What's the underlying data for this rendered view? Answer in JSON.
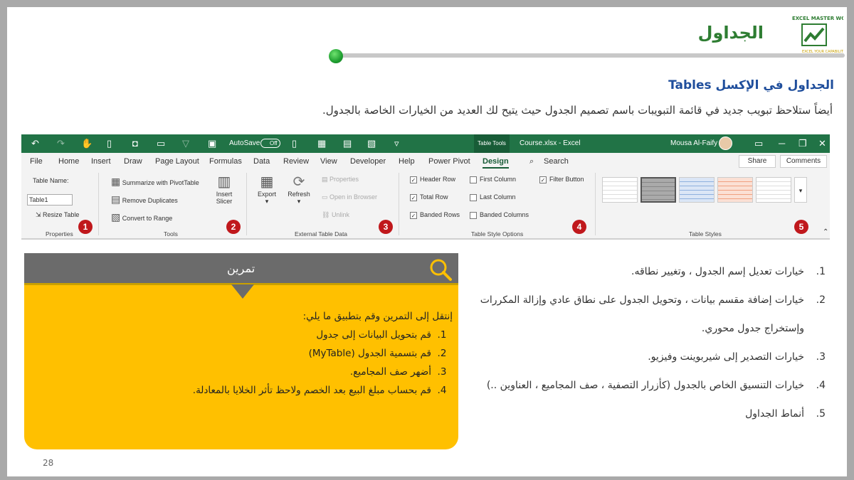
{
  "slide": {
    "title": "الجداول",
    "subtitle": "الجداول في الإكسل Tables",
    "intro": "أيضاً ستلاحظ تبويب جديد في قائمة التبويبات باسم تصميم الجدول حيث يتيح لك العديد من الخيارات الخاصة بالجدول.",
    "page": "28"
  },
  "logo": {
    "brand": "EXCEL MASTER WORK",
    "tagline": "EXCEL YOUR CAPABILITY"
  },
  "excel": {
    "autosave": "AutoSave",
    "autosave_state": "Off",
    "table_tools": "Table Tools",
    "filename": "Course.xlsx - Excel",
    "user": "Mousa Al-Faify",
    "tabs": [
      "File",
      "Home",
      "Insert",
      "Draw",
      "Page Layout",
      "Formulas",
      "Data",
      "Review",
      "View",
      "Developer",
      "Help",
      "Power Pivot",
      "Design"
    ],
    "search": "Search",
    "share": "Share",
    "comments": "Comments",
    "properties": {
      "table_name_label": "Table Name:",
      "table_name": "Table1",
      "resize": "Resize Table",
      "label": "Properties"
    },
    "tools": {
      "summarize": "Summarize with PivotTable",
      "remove_dup": "Remove Duplicates",
      "convert": "Convert to Range",
      "slicer1": "Insert",
      "slicer2": "Slicer",
      "label": "Tools"
    },
    "external": {
      "export": "Export",
      "refresh": "Refresh",
      "props": "Properties",
      "open_browser": "Open in Browser",
      "unlink": "Unlink",
      "label": "External Table Data"
    },
    "options": {
      "header_row": "Header Row",
      "total_row": "Total Row",
      "banded_rows": "Banded Rows",
      "first_col": "First Column",
      "last_col": "Last Column",
      "banded_cols": "Banded Columns",
      "filter_btn": "Filter Button",
      "label": "Table Style Options"
    },
    "styles": {
      "label": "Table Styles"
    },
    "badges": [
      "1",
      "2",
      "3",
      "4",
      "5"
    ]
  },
  "exercise": {
    "title": "تمرين",
    "intro": "إنتقل إلى التمرين وقم بتطبيق ما يلي:",
    "items": [
      {
        "n": "1.",
        "t": "قم بتحويل البيانات إلى جدول"
      },
      {
        "n": "2.",
        "t": "قم بتسمية الجدول (MyTable)"
      },
      {
        "n": "3.",
        "t": "أضهر صف المجاميع."
      },
      {
        "n": "4.",
        "t": "قم بحساب مبلغ البيع بعد الخصم ولاحظ تأثر الخلايا بالمعادلة."
      }
    ]
  },
  "list": [
    {
      "n": "1.",
      "t": "خيارات تعديل إسم الجدول ، وتغيير نطاقه."
    },
    {
      "n": "2.",
      "t": "خيارات إضافة مقسم بيانات ، وتحويل الجدول على نطاق عادي وإزالة المكررات وإستخراج جدول محوري."
    },
    {
      "n": "3.",
      "t": "خيارات التصدير إلى شيربوينت وفيزيو."
    },
    {
      "n": "4.",
      "t": "خيارات التنسيق الخاص بالجدول (كأزرار التصفية ، صف المجاميع ، العناوين ..)"
    },
    {
      "n": "5.",
      "t": "أنماط الجداول"
    }
  ]
}
